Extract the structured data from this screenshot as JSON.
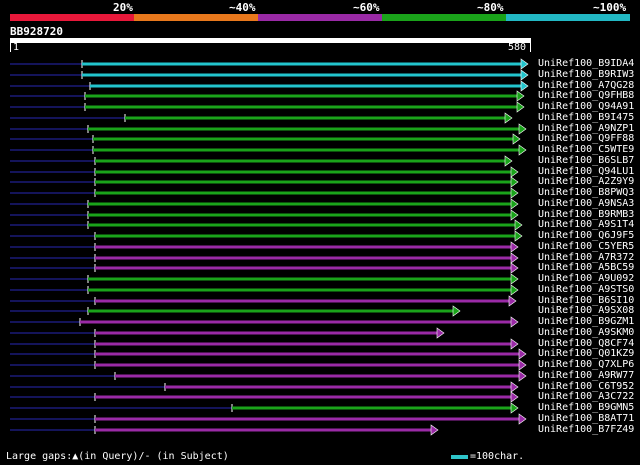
{
  "legend": {
    "labels": [
      "20%",
      "~40%",
      "~60%",
      "~80%",
      "~100%"
    ],
    "segments": [
      {
        "color": "#e8183a",
        "identity_band": "20%"
      },
      {
        "color": "#e8781c",
        "identity_band": "~40%"
      },
      {
        "color": "#9a2aa6",
        "identity_band": "~60%"
      },
      {
        "color": "#1aa31a",
        "identity_band": "~80%"
      },
      {
        "color": "#22b8c4",
        "identity_band": "~100%"
      }
    ]
  },
  "query": {
    "id": "BB928720",
    "length": 580,
    "start_label": "1",
    "end_label": "580"
  },
  "colors": {
    "cyan": "#22c4cc",
    "green": "#1aa31a",
    "purple": "#9a2aa6",
    "navy": "#14145a",
    "background": "#000000"
  },
  "hits": [
    {
      "label": "UniRef100_B9IDA4",
      "color": "cyan",
      "start": 82,
      "end": 528,
      "arrow": true
    },
    {
      "label": "UniRef100_B9RIW3",
      "color": "cyan",
      "start": 82,
      "end": 528,
      "arrow": true
    },
    {
      "label": "UniRef100_A7QG28",
      "color": "cyan",
      "start": 90,
      "end": 528,
      "arrow": true
    },
    {
      "label": "UniRef100_Q9FHB8",
      "color": "green",
      "start": 85,
      "end": 524,
      "arrow": true
    },
    {
      "label": "UniRef100_Q94A91",
      "color": "green",
      "start": 85,
      "end": 524,
      "arrow": true
    },
    {
      "label": "UniRef100_B9I475",
      "color": "green",
      "start": 125,
      "end": 512,
      "arrow": true
    },
    {
      "label": "UniRef100_A9NZP1",
      "color": "green",
      "start": 88,
      "end": 526,
      "arrow": true
    },
    {
      "label": "UniRef100_Q9FF88",
      "color": "green",
      "start": 93,
      "end": 520,
      "arrow": true
    },
    {
      "label": "UniRef100_C5WTE9",
      "color": "green",
      "start": 93,
      "end": 526,
      "arrow": true
    },
    {
      "label": "UniRef100_B6SLB7",
      "color": "green",
      "start": 95,
      "end": 512,
      "arrow": true
    },
    {
      "label": "UniRef100_Q94LU1",
      "color": "green",
      "start": 95,
      "end": 518,
      "arrow": true
    },
    {
      "label": "UniRef100_A2Z9Y9",
      "color": "green",
      "start": 95,
      "end": 518,
      "arrow": true
    },
    {
      "label": "UniRef100_B8PWQ3",
      "color": "green",
      "start": 95,
      "end": 518,
      "arrow": true
    },
    {
      "label": "UniRef100_A9NSA3",
      "color": "green",
      "start": 88,
      "end": 518,
      "arrow": true
    },
    {
      "label": "UniRef100_B9RMB3",
      "color": "green",
      "start": 88,
      "end": 518,
      "arrow": true
    },
    {
      "label": "UniRef100_A9S1T4",
      "color": "green",
      "start": 88,
      "end": 522,
      "arrow": true
    },
    {
      "label": "UniRef100_Q6J9F5",
      "color": "green",
      "start": 95,
      "end": 522,
      "arrow": true
    },
    {
      "label": "UniRef100_C5YER5",
      "color": "purple",
      "start": 95,
      "end": 518,
      "arrow": true
    },
    {
      "label": "UniRef100_A7R372",
      "color": "purple",
      "start": 95,
      "end": 518,
      "arrow": true
    },
    {
      "label": "UniRef100_A5BC59",
      "color": "purple",
      "start": 95,
      "end": 518,
      "arrow": true
    },
    {
      "label": "UniRef100_A9U092",
      "color": "green",
      "start": 88,
      "end": 518,
      "arrow": true
    },
    {
      "label": "UniRef100_A9STS0",
      "color": "green",
      "start": 88,
      "end": 518,
      "arrow": true
    },
    {
      "label": "UniRef100_B6SI10",
      "color": "purple",
      "start": 95,
      "end": 516,
      "arrow": true
    },
    {
      "label": "UniRef100_A9SX08",
      "color": "green",
      "start": 88,
      "end": 460,
      "arrow": true
    },
    {
      "label": "UniRef100_B9GZM1",
      "color": "purple",
      "start": 80,
      "end": 518,
      "arrow": true
    },
    {
      "label": "UniRef100_A9SKM0",
      "color": "purple",
      "start": 95,
      "end": 444,
      "arrow": true
    },
    {
      "label": "UniRef100_Q8CF74",
      "color": "purple",
      "start": 95,
      "end": 518,
      "arrow": true
    },
    {
      "label": "UniRef100_Q01KZ9",
      "color": "purple",
      "start": 95,
      "end": 526,
      "arrow": true
    },
    {
      "label": "UniRef100_Q7XLP6",
      "color": "purple",
      "start": 95,
      "end": 526,
      "arrow": true
    },
    {
      "label": "UniRef100_A9RW77",
      "color": "purple",
      "start": 115,
      "end": 526,
      "arrow": true
    },
    {
      "label": "UniRef100_C6T952",
      "color": "purple",
      "start": 165,
      "end": 518,
      "arrow": true
    },
    {
      "label": "UniRef100_A3C722",
      "color": "purple",
      "start": 95,
      "end": 518,
      "arrow": true
    },
    {
      "label": "UniRef100_B9GMN5",
      "color": "green",
      "start": 232,
      "end": 518,
      "arrow": true
    },
    {
      "label": "UniRef100_B8AT71",
      "color": "purple",
      "start": 95,
      "end": 526,
      "arrow": true
    },
    {
      "label": "UniRef100_B7FZ49",
      "color": "purple",
      "start": 95,
      "end": 438,
      "arrow": true
    }
  ],
  "footer": {
    "gaps_text": "Large gaps:▲(in Query)/- (in Subject)",
    "scale_text": "=100char."
  }
}
